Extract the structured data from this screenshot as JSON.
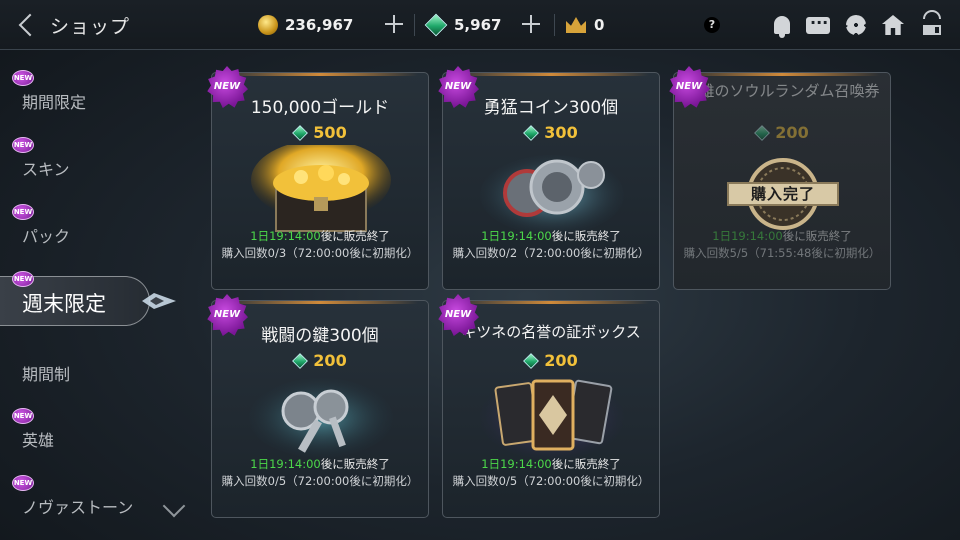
{
  "header": {
    "title": "ショップ",
    "gold": "236,967",
    "gems": "5,967",
    "crowns": "0",
    "help": "?"
  },
  "sidebar": {
    "items": [
      {
        "label": "期間限定",
        "new": true
      },
      {
        "label": "スキン",
        "new": true
      },
      {
        "label": "パック",
        "new": true
      },
      {
        "label": "週末限定",
        "new": true,
        "active": true
      },
      {
        "label": "期間制",
        "new": false
      },
      {
        "label": "英雄",
        "new": true
      },
      {
        "label": "ノヴァストーン",
        "new": true
      }
    ],
    "new_badge": "NEW"
  },
  "cards": [
    {
      "name": "150,000ゴールド",
      "price": "500",
      "timer_highlight": "1日19:14:00",
      "timer_suffix": "後に販売終了",
      "count": "購入回数0/3（72:00:00後に初期化）",
      "new": "NEW",
      "art": "gold-chest"
    },
    {
      "name": "勇猛コイン300個",
      "price": "300",
      "timer_highlight": "1日19:14:00",
      "timer_suffix": "後に販売終了",
      "count": "購入回数0/2（72:00:00後に初期化）",
      "new": "NEW",
      "art": "lion-coins"
    },
    {
      "name": "英雄のソウルランダム召喚券",
      "price": "200",
      "timer_highlight": "1日19:14:00",
      "timer_suffix": "後に販売終了",
      "count": "購入回数5/5（71:55:48後に初期化）",
      "new": "NEW",
      "art": "soul-ticket",
      "stamp": "購入完了"
    },
    {
      "name": "戦闘の鍵300個",
      "price": "200",
      "timer_highlight": "1日19:14:00",
      "timer_suffix": "後に販売終了",
      "count": "購入回数0/5（72:00:00後に初期化）",
      "new": "NEW",
      "art": "keys"
    },
    {
      "name": "キツネの名誉の証ボックス",
      "price": "200",
      "timer_highlight": "1日19:14:00",
      "timer_suffix": "後に販売終了",
      "count": "購入回数0/5（72:00:00後に初期化）",
      "new": "NEW",
      "art": "card-box"
    }
  ],
  "colors": {
    "accent_green": "#4cd84a",
    "price_gold": "#f2c13a",
    "new_purple": "#a02bc0"
  }
}
